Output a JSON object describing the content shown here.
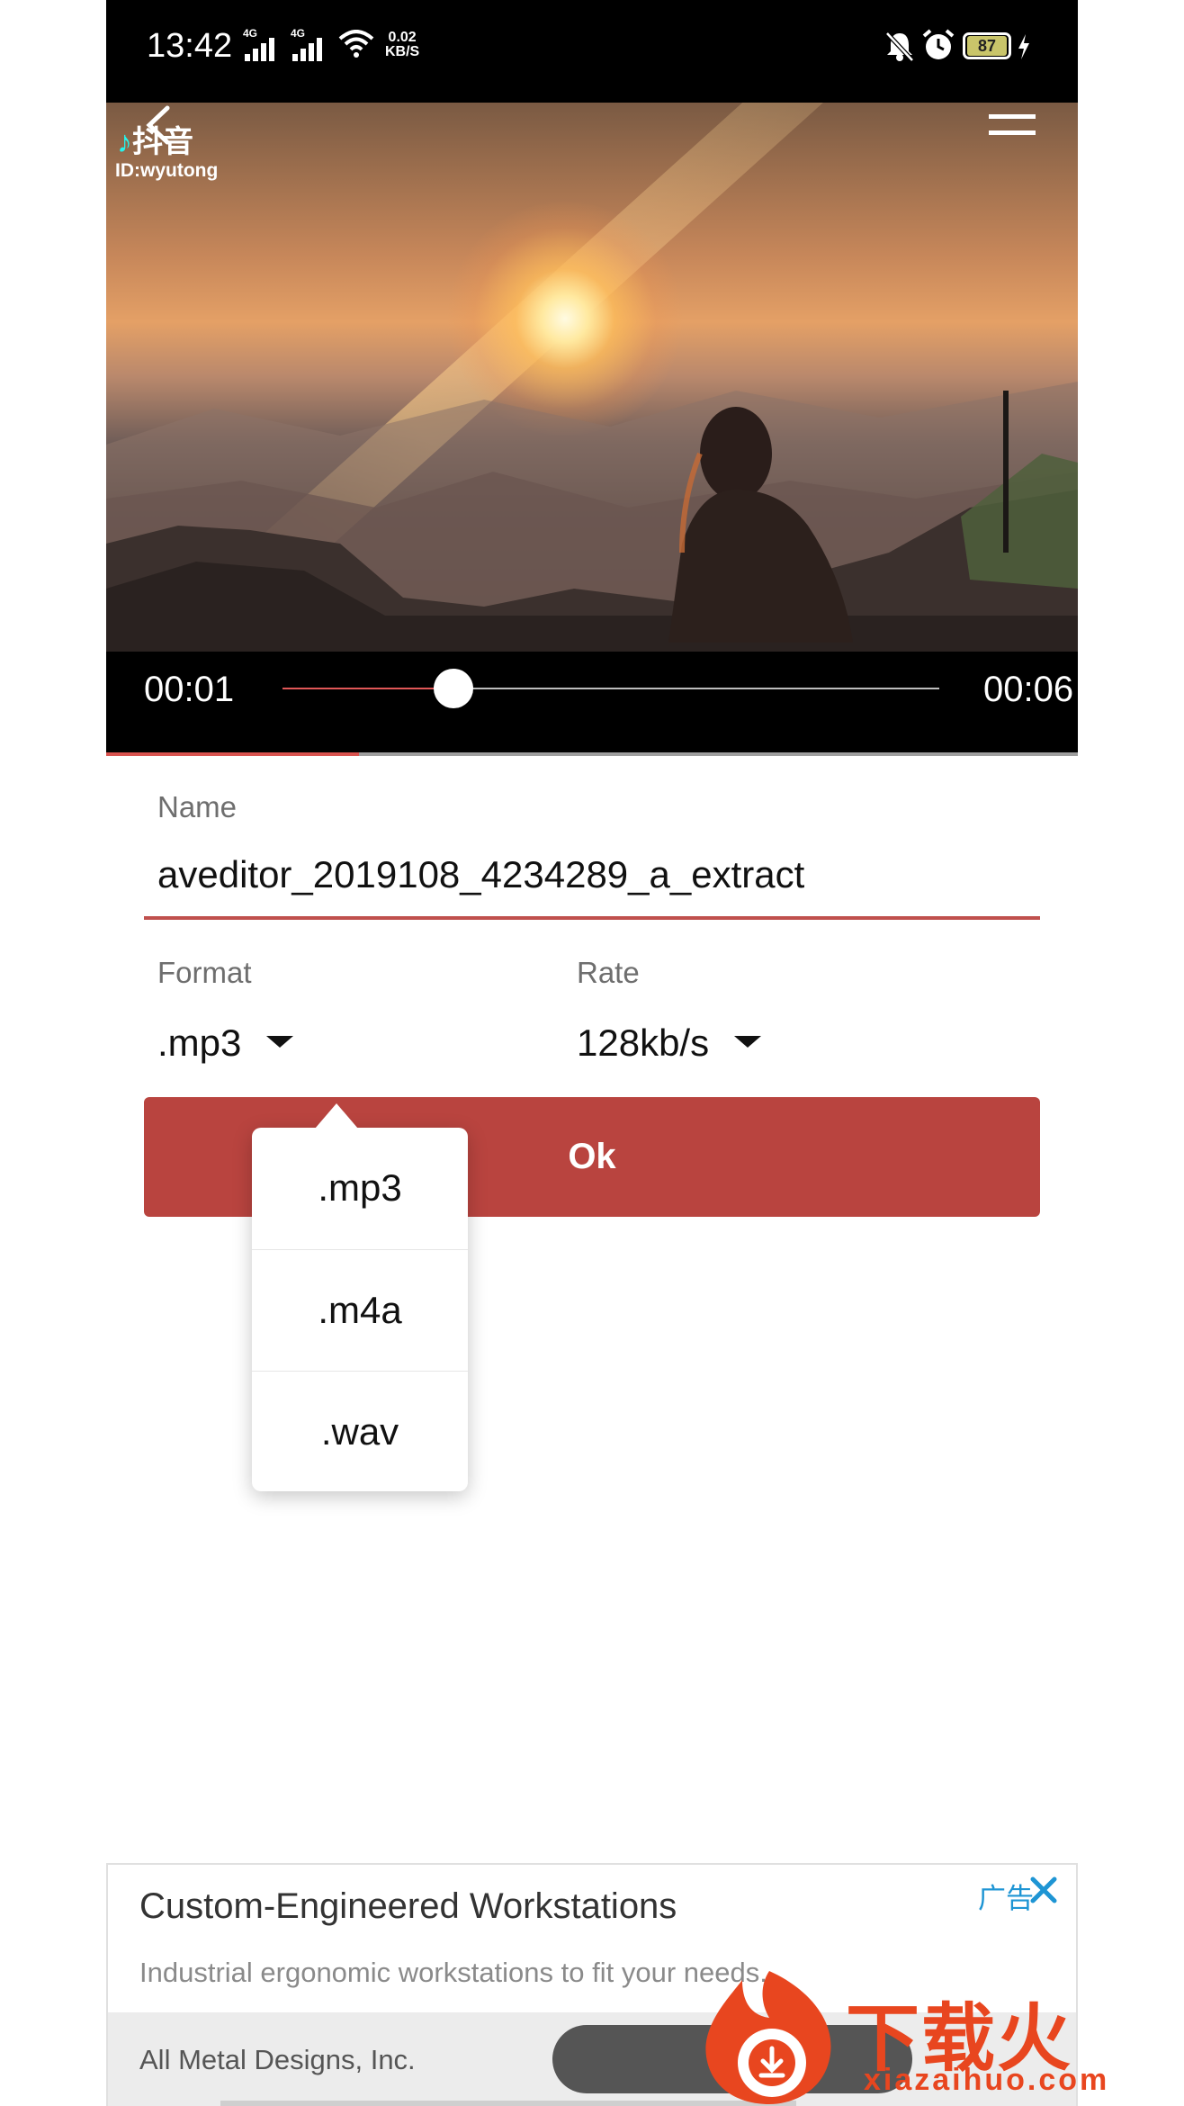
{
  "status_bar": {
    "time": "13:42",
    "signal_1": "4G",
    "signal_2": "4G",
    "net_speed_value": "0.02",
    "net_speed_unit": "KB/S",
    "battery": "87"
  },
  "video": {
    "watermark_app": "抖音",
    "watermark_id": "ID:wyutong",
    "current_time": "00:01",
    "total_time": "00:06",
    "seek_fraction": 0.26,
    "progress_fraction": 0.26
  },
  "form": {
    "name_label": "Name",
    "name_value": "aveditor_2019108_4234289_a_extract",
    "format_label": "Format",
    "format_value": ".mp3",
    "rate_label": "Rate",
    "rate_value": "128kb/s",
    "ok_label": "Ok"
  },
  "format_dropdown": {
    "options": [
      ".mp3",
      ".m4a",
      ".wav"
    ]
  },
  "ad": {
    "title": "Custom-Engineered Workstations",
    "subtitle": "Industrial ergonomic workstations to fit your needs.",
    "badge": "广告",
    "company": "All Metal Designs, Inc."
  },
  "watermark": {
    "text": "下载火",
    "url": "xiazaihuo.com"
  },
  "colors": {
    "accent": "#b9443f",
    "underline": "#c0504d",
    "seek_fill": "#e05757",
    "ad_badge": "#1e95d4",
    "watermark": "#e8461f"
  },
  "icons": {
    "back": "back-arrow-icon",
    "menu": "hamburger-menu-icon",
    "ad_close": "close-icon",
    "mute": "bell-off-icon",
    "alarm": "alarm-icon",
    "wifi": "wifi-icon",
    "charging": "lightning-icon"
  }
}
